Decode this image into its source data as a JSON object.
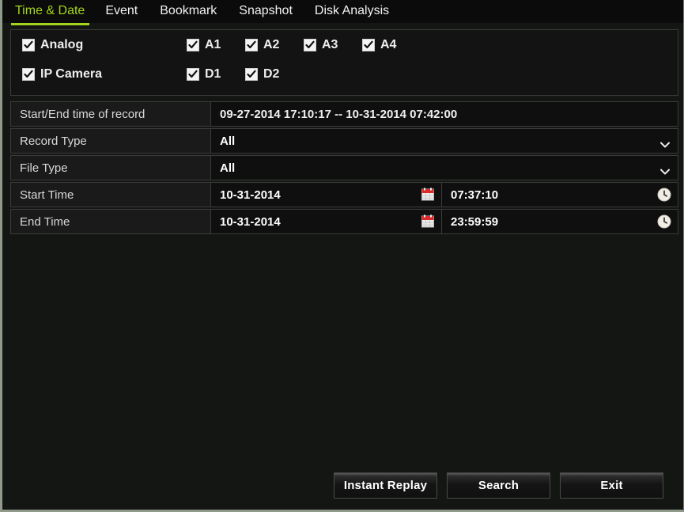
{
  "colors": {
    "active_tab": "#a4d41e",
    "panel_bg": "#141614",
    "row_label_bg": "#191a19",
    "calendar_icon_red": "#d92b2b",
    "text": "#eeeeee"
  },
  "tabs": [
    {
      "label": "Time & Date",
      "active": true
    },
    {
      "label": "Event",
      "active": false
    },
    {
      "label": "Bookmark",
      "active": false
    },
    {
      "label": "Snapshot",
      "active": false
    },
    {
      "label": "Disk Analysis",
      "active": false
    }
  ],
  "channels": {
    "analog": {
      "group_label": "Analog",
      "group_checked": true,
      "items": [
        {
          "label": "A1",
          "checked": true
        },
        {
          "label": "A2",
          "checked": true
        },
        {
          "label": "A3",
          "checked": true
        },
        {
          "label": "A4",
          "checked": true
        }
      ]
    },
    "ip_camera": {
      "group_label": "IP Camera",
      "group_checked": true,
      "items": [
        {
          "label": "D1",
          "checked": true
        },
        {
          "label": "D2",
          "checked": true
        }
      ]
    }
  },
  "form": {
    "record_span": {
      "label": "Start/End time of record",
      "value": "09-27-2014 17:10:17 -- 10-31-2014 07:42:00"
    },
    "record_type": {
      "label": "Record Type",
      "value": "All",
      "options": [
        "All"
      ]
    },
    "file_type": {
      "label": "File Type",
      "value": "All",
      "options": [
        "All"
      ]
    },
    "start_time": {
      "label": "Start Time",
      "date": "10-31-2014",
      "time": "07:37:10"
    },
    "end_time": {
      "label": "End Time",
      "date": "10-31-2014",
      "time": "23:59:59"
    }
  },
  "icons": {
    "calendar": "calendar-icon",
    "clock": "clock-icon",
    "chevron": "chevron-down-icon",
    "check": "check-icon"
  },
  "footer": {
    "instant_replay": "Instant Replay",
    "search": "Search",
    "exit": "Exit"
  }
}
